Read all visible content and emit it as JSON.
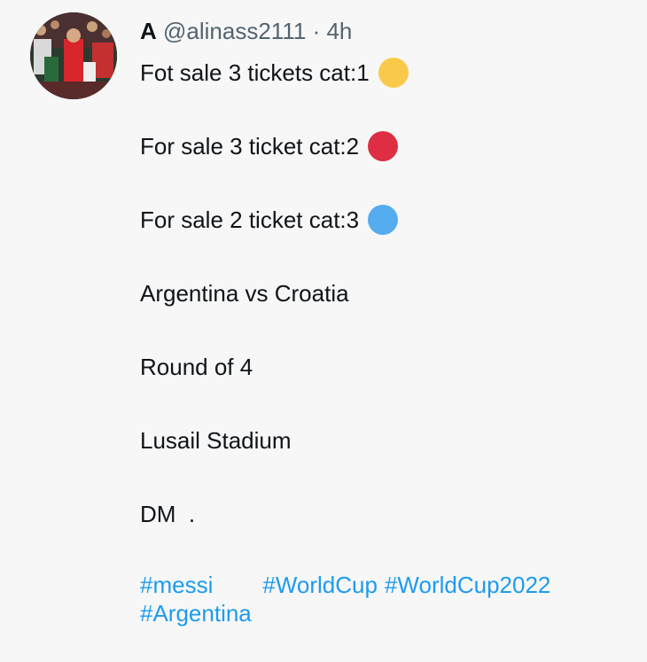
{
  "tweet": {
    "author_name": "A",
    "handle": "@alinass2111",
    "separator": "·",
    "time": "4h",
    "lines": [
      {
        "text": "Fot sale 3 tickets cat:1",
        "emoji": "yellow-circle",
        "color": "#fbc94a"
      },
      {
        "text": "For sale 3 ticket cat:2",
        "emoji": "red-circle",
        "color": "#dd2e44"
      },
      {
        "text": "For sale 2 ticket cat:3",
        "emoji": "blue-circle",
        "color": "#55acee"
      },
      {
        "text": "Argentina vs Croatia"
      },
      {
        "text": "Round of 4"
      },
      {
        "text": "Lusail Stadium"
      },
      {
        "text": "DM  ."
      }
    ],
    "hashtags": [
      "#messi",
      "#WorldCup",
      "#WorldCup2022",
      "#Argentina"
    ]
  },
  "colors": {
    "link": "#1d9bf0",
    "muted": "#536471",
    "background": "#f7f7f7"
  }
}
